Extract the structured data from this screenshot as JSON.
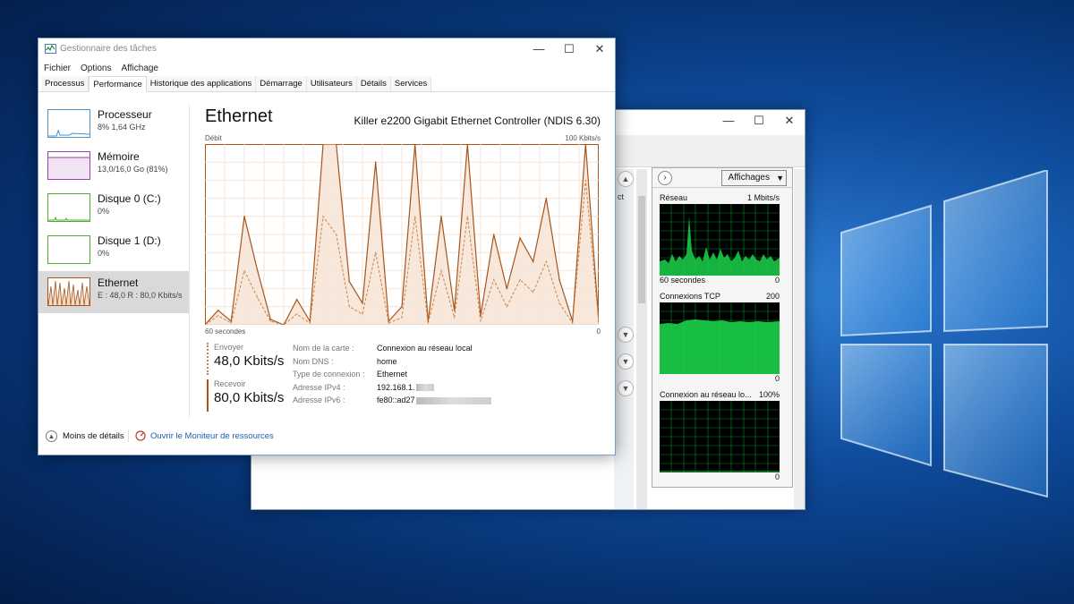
{
  "task_manager": {
    "title": "Gestionnaire des tâches",
    "window_controls": {
      "minimize": "—",
      "maximize": "☐",
      "close": "✕"
    },
    "menu": [
      "Fichier",
      "Options",
      "Affichage"
    ],
    "tabs": [
      "Processus",
      "Performance",
      "Historique des applications",
      "Démarrage",
      "Utilisateurs",
      "Détails",
      "Services"
    ],
    "active_tab": "Performance",
    "sidebar": [
      {
        "name": "Processeur",
        "sub": "8% 1,64 GHz",
        "color": "#4a90c8"
      },
      {
        "name": "Mémoire",
        "sub": "13,0/16,0 Go (81%)",
        "color": "#9a3fb0"
      },
      {
        "name": "Disque 0 (C:)",
        "sub": "0%",
        "color": "#4caf2a"
      },
      {
        "name": "Disque 1 (D:)",
        "sub": "0%",
        "color": "#4caf2a"
      },
      {
        "name": "Ethernet",
        "sub": "E : 48,0 R : 80,0 Kbits/s",
        "color": "#a8541a"
      }
    ],
    "main": {
      "heading": "Ethernet",
      "adapter": "Killer e2200 Gigabit Ethernet Controller (NDIS 6.30)",
      "graph_label": "Débit",
      "graph_max": "100 Kbits/s",
      "graph_time": "60 secondes",
      "graph_min": "0",
      "send_label": "Envoyer",
      "send_value": "48,0 Kbits/s",
      "recv_label": "Recevoir",
      "recv_value": "80,0 Kbits/s",
      "properties": [
        {
          "key": "Nom de la carte :",
          "value": "Connexion au réseau local"
        },
        {
          "key": "Nom DNS :",
          "value": "home"
        },
        {
          "key": "Type de connexion :",
          "value": "Ethernet"
        },
        {
          "key": "Adresse IPv4 :",
          "value": "192.168.1."
        },
        {
          "key": "Adresse IPv6 :",
          "value": "fe80::ad27"
        }
      ]
    },
    "footer": {
      "less_details": "Moins de détails",
      "resource_monitor_link": "Ouvrir le Moniteur de ressources"
    }
  },
  "resource_monitor": {
    "window_controls": {
      "minimize": "—",
      "maximize": "☐",
      "close": "✕"
    },
    "views_button": "Affichages",
    "left_fragment": "ct",
    "graphs": [
      {
        "label": "Réseau",
        "max": "1 Mbits/s",
        "time": "60 secondes",
        "min": "0"
      },
      {
        "label": "Connexions TCP",
        "max": "200",
        "time": "",
        "min": "0"
      },
      {
        "label": "Connexion au réseau lo...",
        "max": "100%",
        "time": "",
        "min": "0"
      }
    ]
  },
  "chart_data": {
    "type": "line",
    "xlabel": "60 secondes",
    "ylabel": "Débit",
    "ylim": [
      0,
      100
    ],
    "x": [
      60,
      58,
      56,
      54,
      52,
      50,
      48,
      46,
      44,
      42,
      40,
      38,
      36,
      34,
      32,
      30,
      28,
      26,
      24,
      22,
      20,
      18,
      16,
      14,
      12,
      10,
      8,
      6,
      4,
      2,
      0
    ],
    "series": [
      {
        "name": "Recevoir",
        "values": [
          0,
          8,
          2,
          60,
          30,
          3,
          0,
          14,
          2,
          100,
          100,
          24,
          12,
          90,
          2,
          10,
          100,
          2,
          60,
          8,
          100,
          5,
          50,
          20,
          48,
          35,
          70,
          25,
          2,
          100,
          2
        ]
      },
      {
        "name": "Envoyer",
        "values": [
          0,
          5,
          1,
          30,
          15,
          2,
          0,
          6,
          1,
          60,
          50,
          10,
          6,
          40,
          1,
          4,
          60,
          1,
          30,
          4,
          60,
          2,
          25,
          10,
          25,
          18,
          35,
          12,
          1,
          80,
          1
        ]
      }
    ]
  }
}
